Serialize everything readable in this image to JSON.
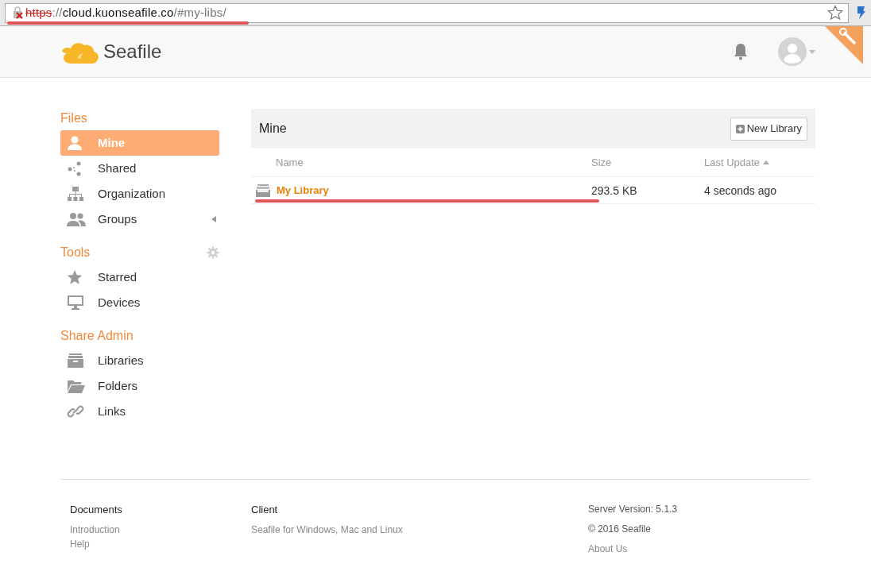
{
  "address_bar": {
    "scheme": "https",
    "separator": "://",
    "host": "cloud.kuonseafile.co",
    "path": "/#my-libs/"
  },
  "header": {
    "logo_text": "Seafile"
  },
  "sidebar": {
    "sections": [
      {
        "title": "Files",
        "gear": false,
        "items": [
          {
            "label": "Mine",
            "kind": "user",
            "selected": true
          },
          {
            "label": "Shared",
            "kind": "share",
            "selected": false
          },
          {
            "label": "Organization",
            "kind": "org",
            "selected": false
          },
          {
            "label": "Groups",
            "kind": "groups",
            "selected": false,
            "expanded": false
          }
        ]
      },
      {
        "title": "Tools",
        "gear": true,
        "items": [
          {
            "label": "Starred",
            "kind": "star",
            "selected": false
          },
          {
            "label": "Devices",
            "kind": "monitor",
            "selected": false
          }
        ]
      },
      {
        "title": "Share Admin",
        "gear": false,
        "items": [
          {
            "label": "Libraries",
            "kind": "archive",
            "selected": false
          },
          {
            "label": "Folders",
            "kind": "folder",
            "selected": false
          },
          {
            "label": "Links",
            "kind": "link",
            "selected": false
          }
        ]
      }
    ]
  },
  "main": {
    "title": "Mine",
    "new_button": "New Library",
    "table": {
      "columns": [
        {
          "label": "Name",
          "sorted": false
        },
        {
          "label": "Size",
          "sorted": false
        },
        {
          "label": "Last Update",
          "sorted": true
        }
      ],
      "rows": [
        {
          "name": "My Library",
          "size": "293.5 KB",
          "updated": "4 seconds ago"
        }
      ]
    }
  },
  "footer": {
    "columns": [
      {
        "title": "Documents",
        "links": [
          "Introduction",
          "Help"
        ]
      },
      {
        "title": "Client",
        "links": [
          "Seafile for Windows, Mac and Linux"
        ]
      }
    ],
    "server_version": "Server Version: 5.1.3",
    "copyright": "© 2016 Seafile",
    "about": "About Us"
  }
}
